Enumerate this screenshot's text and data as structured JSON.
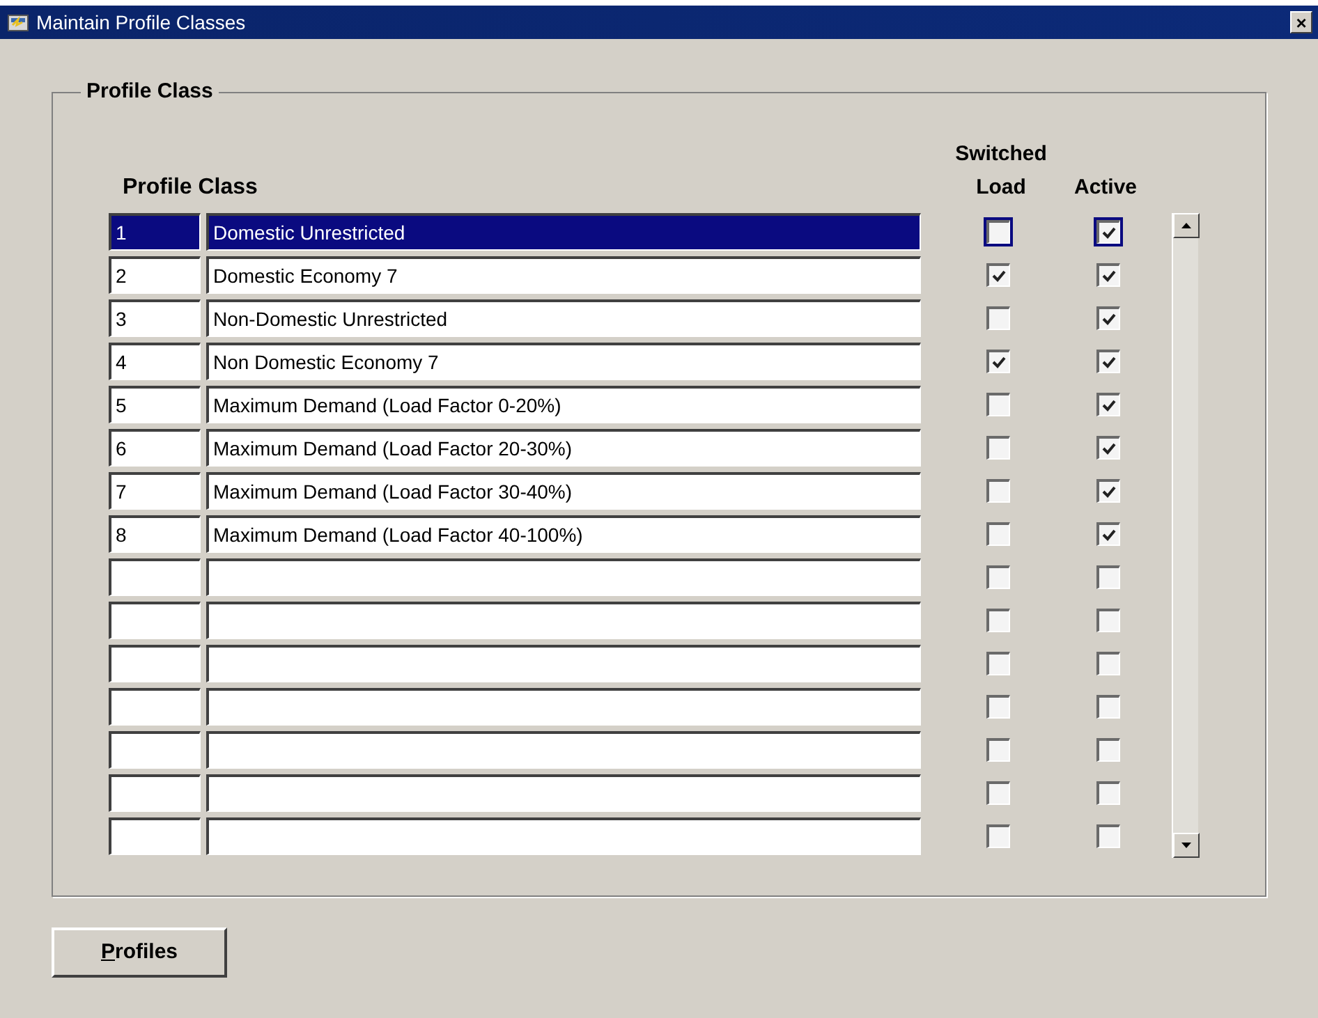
{
  "window": {
    "title": "Maintain Profile Classes",
    "close": "×"
  },
  "group": {
    "title": "Profile Class"
  },
  "columns": {
    "profile_class": "Profile Class",
    "switched_load": [
      "Switched",
      "Load"
    ],
    "active": "Active"
  },
  "rows": [
    {
      "number": "1",
      "name": "Domestic Unrestricted",
      "selected": true,
      "switched_load": false,
      "active": true
    },
    {
      "number": "2",
      "name": "Domestic Economy 7",
      "selected": false,
      "switched_load": true,
      "active": true
    },
    {
      "number": "3",
      "name": "Non-Domestic Unrestricted",
      "selected": false,
      "switched_load": false,
      "active": true
    },
    {
      "number": "4",
      "name": "Non Domestic Economy 7",
      "selected": false,
      "switched_load": true,
      "active": true
    },
    {
      "number": "5",
      "name": "Maximum Demand (Load Factor 0-20%)",
      "selected": false,
      "switched_load": false,
      "active": true
    },
    {
      "number": "6",
      "name": "Maximum Demand (Load Factor 20-30%)",
      "selected": false,
      "switched_load": false,
      "active": true
    },
    {
      "number": "7",
      "name": "Maximum Demand (Load Factor 30-40%)",
      "selected": false,
      "switched_load": false,
      "active": true
    },
    {
      "number": "8",
      "name": "Maximum Demand (Load Factor 40-100%)",
      "selected": false,
      "switched_load": false,
      "active": true
    },
    {
      "selected": false,
      "switched_load": false,
      "active": false
    },
    {
      "selected": false,
      "switched_load": false,
      "active": false
    },
    {
      "selected": false,
      "switched_load": false,
      "active": false
    },
    {
      "selected": false,
      "switched_load": false,
      "active": false
    },
    {
      "selected": false,
      "switched_load": false,
      "active": false
    },
    {
      "selected": false,
      "switched_load": false,
      "active": false
    },
    {
      "selected": false,
      "switched_load": false,
      "active": false
    }
  ],
  "buttons": [
    {
      "label": "Profiles"
    }
  ]
}
